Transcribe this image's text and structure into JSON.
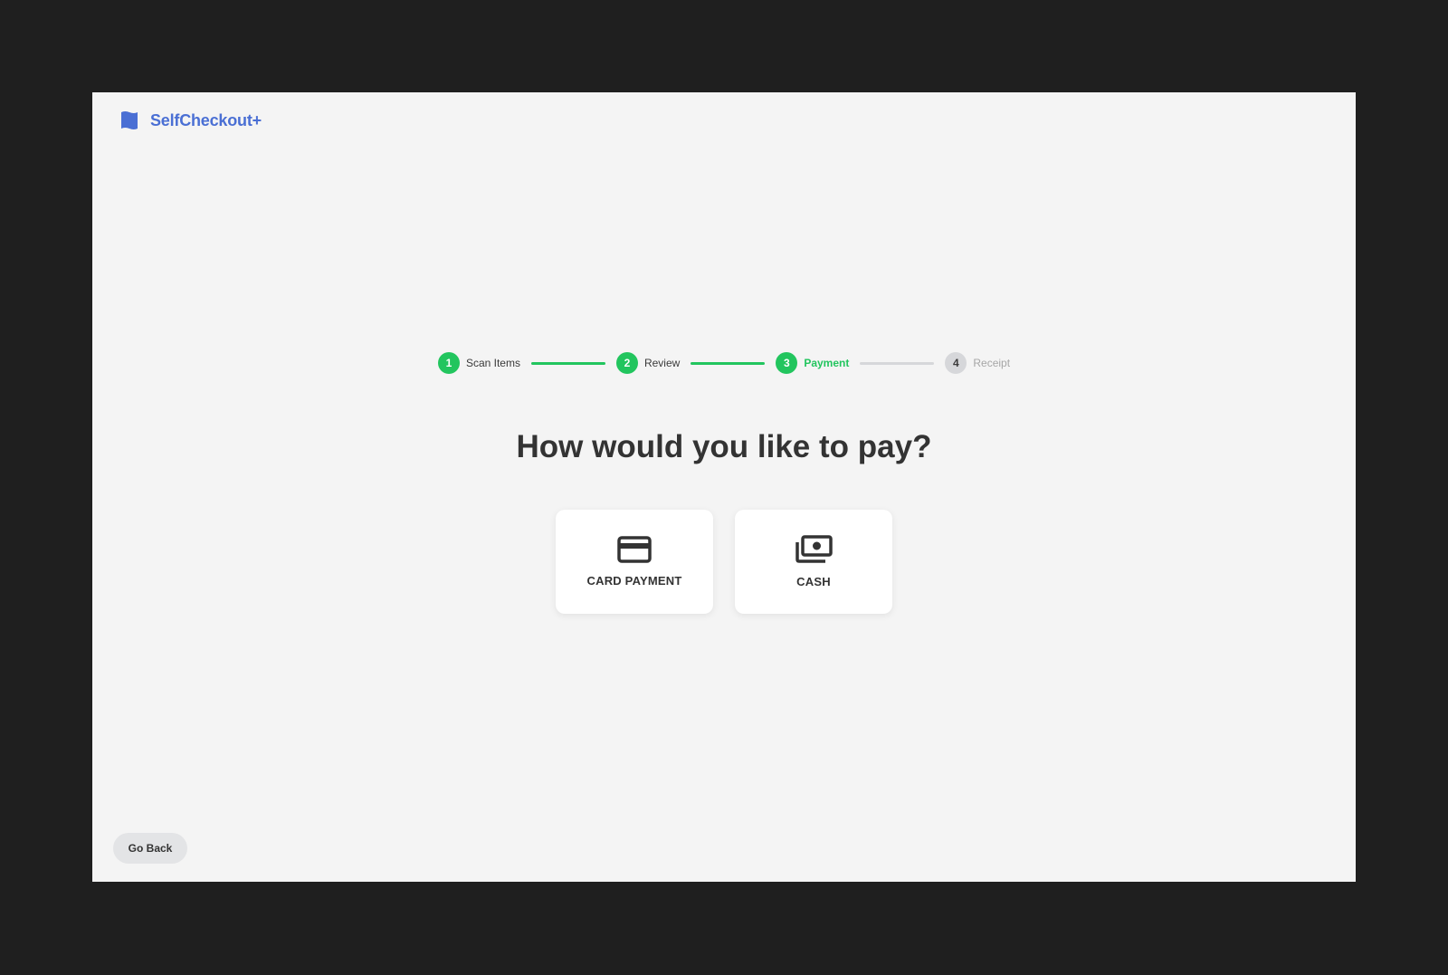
{
  "app": {
    "brand_name": "SelfCheckout+",
    "brand_icon": "flag-icon",
    "brand_color": "#4a6fd4"
  },
  "stepper": {
    "steps": [
      {
        "number": "1",
        "label": "Scan Items",
        "status": "complete"
      },
      {
        "number": "2",
        "label": "Review",
        "status": "complete"
      },
      {
        "number": "3",
        "label": "Payment",
        "status": "active"
      },
      {
        "number": "4",
        "label": "Receipt",
        "status": "pending"
      }
    ],
    "accent_color": "#22c55e",
    "pending_color": "#d6d7da"
  },
  "main": {
    "title": "How would you like to pay?",
    "options": [
      {
        "label": "CARD PAYMENT",
        "icon": "credit-card-icon"
      },
      {
        "label": "CASH",
        "icon": "cash-icon"
      }
    ]
  },
  "footer": {
    "back_label": "Go Back"
  }
}
